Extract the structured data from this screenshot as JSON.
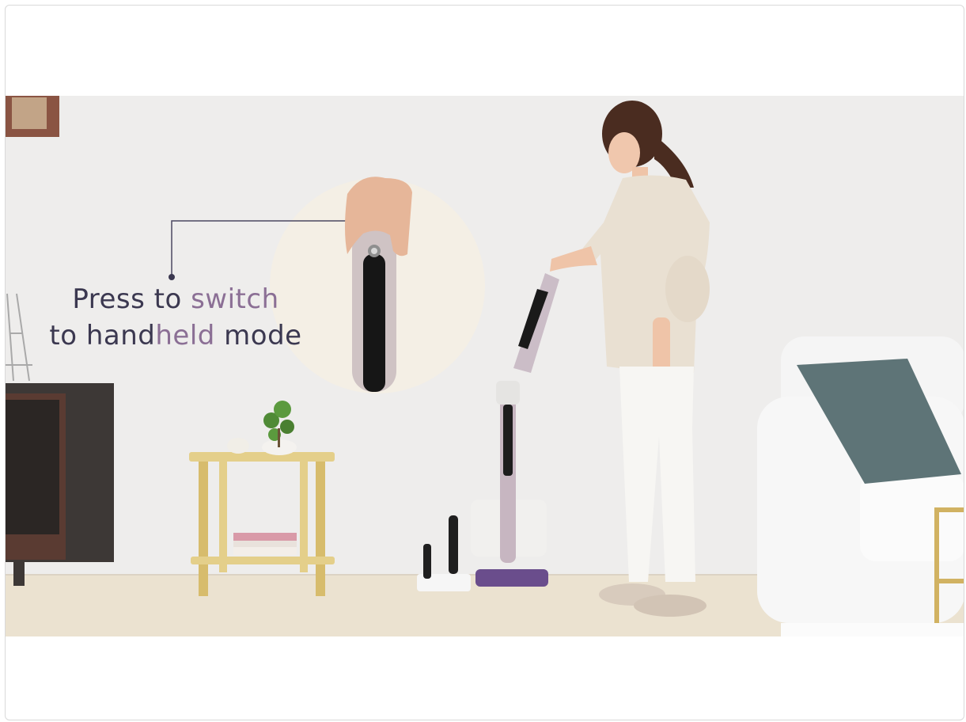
{
  "video": {
    "caption_line1_a": "Press to ",
    "caption_line1_b": "switch",
    "caption_line2_a": "to hand",
    "caption_line2_b": "held",
    "caption_line2_c": " mode",
    "colors": {
      "wall": "#ecebea",
      "floor": "#ece3d2",
      "text": "#3b3850",
      "accent": "#8b6f95",
      "cushion": "#5e7477"
    }
  }
}
